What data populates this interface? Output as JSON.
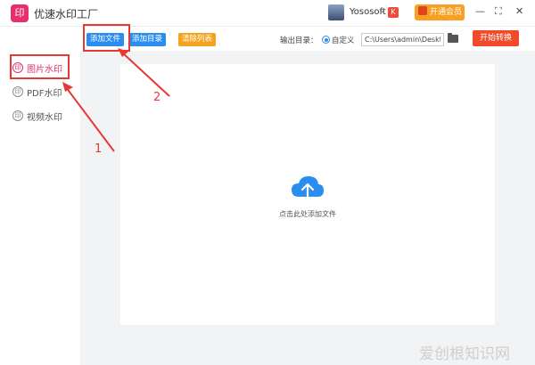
{
  "app": {
    "logo_glyph": "印",
    "title": "优速水印工厂",
    "user_name": "Yososoft",
    "user_badge": "K",
    "vip_label": "开通会员",
    "window_controls": [
      "—",
      "⛶",
      "✕"
    ]
  },
  "sidebar": {
    "items": [
      {
        "icon": "印",
        "label": "图片水印",
        "active": true
      },
      {
        "icon": "印",
        "label": "PDF水印",
        "active": false
      },
      {
        "icon": "印",
        "label": "视频水印",
        "active": false
      }
    ]
  },
  "toolbar": {
    "add_file": "添加文件",
    "add_folder": "添加目录",
    "clear_list": "清除列表",
    "output_label": "输出目录：",
    "custom_label": "自定义",
    "output_path": "C:\\Users\\admin\\Deskto",
    "start_label": "开始转换"
  },
  "drop_zone": {
    "hint": "点击此处添加文件"
  },
  "annotations": {
    "step1": "1",
    "step2": "2"
  },
  "watermark": "爱创根知识网",
  "colors": {
    "accent_blue": "#2a8df0",
    "accent_orange": "#f7a21e",
    "start_red": "#f04a2a",
    "brand_pink": "#e5306a",
    "annotation_red": "#e53935"
  }
}
